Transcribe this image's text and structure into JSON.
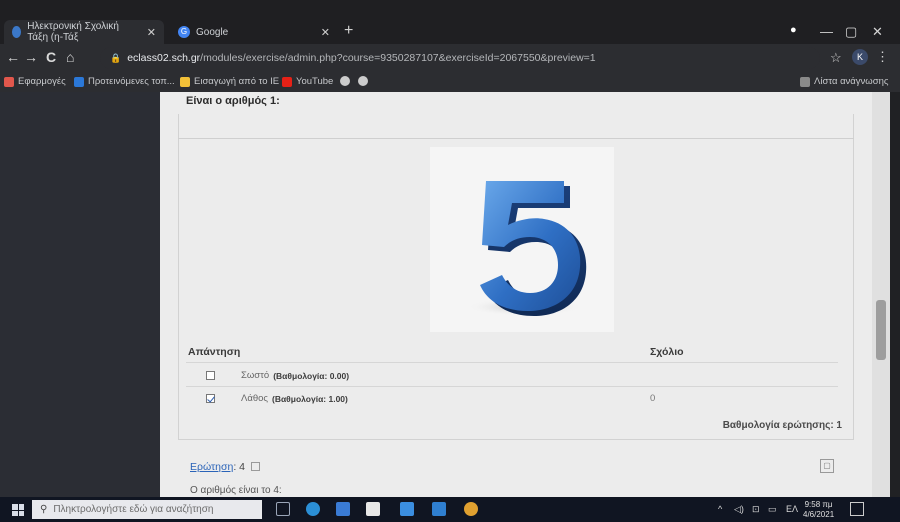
{
  "browser": {
    "tabs": [
      {
        "title": "Ηλεκτρονική Σχολική Τάξη (η-Τάξ",
        "active": true
      },
      {
        "title": "Google",
        "active": false
      }
    ],
    "new_tab": "+",
    "window_controls": {
      "minimize": "—",
      "maximize": "▢",
      "close": "✕"
    },
    "nav": {
      "back": "←",
      "forward": "→",
      "reload": "C",
      "home": "⌂"
    },
    "address": {
      "host": "eclass02.sch.gr",
      "path": "/modules/exercise/admin.php?course=9350287107&exerciseId=2067550&preview=1"
    },
    "star": "☆",
    "profile_initial": "K",
    "menu": "⋮",
    "bookmarks": [
      {
        "label": "Εφαρμογές",
        "icon": "apps-icon",
        "color": "#e2574c"
      },
      {
        "label": "Προτεινόμενες τοπ...",
        "icon": "bookmark-icon",
        "color": "#2b78d8"
      },
      {
        "label": "Εισαγωγή από το IE",
        "icon": "folder-icon",
        "color": "#f2c038"
      },
      {
        "label": "YouTube",
        "icon": "youtube-icon",
        "color": "#e62117"
      },
      {
        "label": "",
        "icon": "globe-icon",
        "color": "#cccccc"
      },
      {
        "label": "",
        "icon": "globe-icon",
        "color": "#cccccc"
      }
    ],
    "reading_list": "Λίστα ανάγνωσης"
  },
  "question": {
    "header": "Είναι ο αριθμός 1:",
    "image_alt": "5",
    "answer_col": "Απάντηση",
    "comment_col": "Σχόλιο",
    "answers": [
      {
        "label": "Σωστό",
        "score": "(Βαθμολογία: 0.00)",
        "checked": false,
        "comment": ""
      },
      {
        "label": "Λάθος",
        "score": "(Βαθμολογία: 1.00)",
        "checked": true,
        "comment": "0"
      }
    ],
    "question_score": "Βαθμολογία ερώτησης: 1"
  },
  "next_question": {
    "label": "Ερώτηση",
    "number": ": 4",
    "text": "Ο αριθμός είναι το 4:"
  },
  "taskbar": {
    "search_placeholder": "Πληκτρολογήστε εδώ για αναζήτηση",
    "lang": "ΕΛ",
    "time": "9:58 πμ",
    "date": "4/6/2021"
  }
}
